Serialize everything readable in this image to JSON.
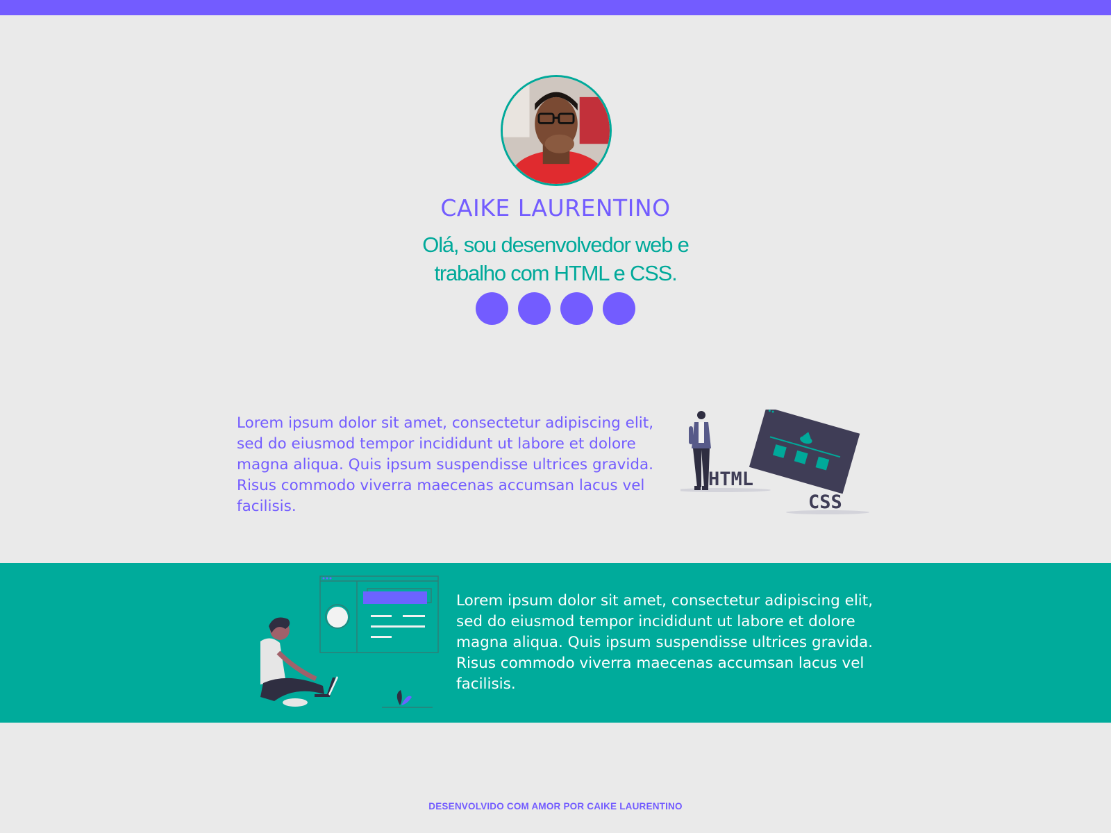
{
  "profile": {
    "name": "CAIKE LAURENTINO",
    "tagline": "Olá, sou desenvolvedor web e trabalho com HTML e CSS.",
    "avatar_icon": "profile-photo"
  },
  "social_links": [
    {
      "icon": "social-icon-1"
    },
    {
      "icon": "social-icon-2"
    },
    {
      "icon": "social-icon-3"
    },
    {
      "icon": "social-icon-4"
    }
  ],
  "about": {
    "text": "Lorem ipsum dolor sit amet, consectetur adipiscing elit, sed do eiusmod tempor incididunt ut labore et dolore magna aliqua. Quis ipsum suspendisse ultrices gravida. Risus commodo viverra maecenas accumsan lacus vel facilisis.",
    "illustration": {
      "html_label": "HTML",
      "css_label": "CSS"
    }
  },
  "work": {
    "text": "Lorem ipsum dolor sit amet, consectetur adipiscing elit, sed do eiusmod tempor incididunt ut labore et dolore magna aliqua. Quis ipsum suspendisse ultrices gravida. Risus commodo viverra maecenas accumsan lacus vel facilisis.",
    "illustration": "person-with-laptop-illustration"
  },
  "footer": {
    "text": "DESENVOLVIDO COM AMOR POR CAIKE LAURENTINO"
  },
  "colors": {
    "primary": "#735cff",
    "accent": "#00a99a",
    "background": "#eaeaea",
    "dark": "#3f3d56"
  }
}
